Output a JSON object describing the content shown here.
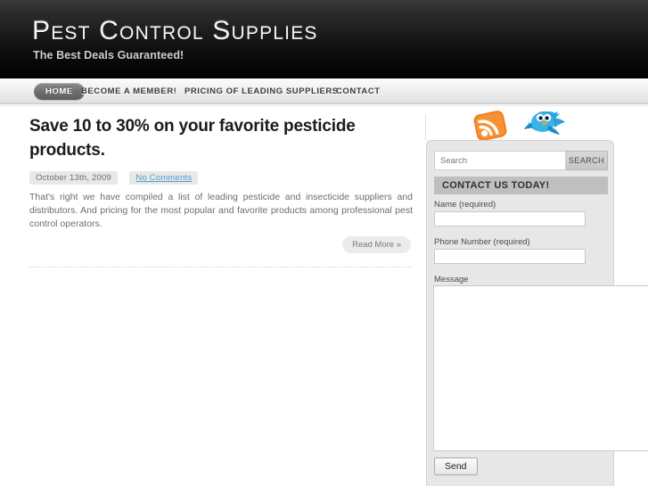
{
  "header": {
    "title": "Pest Control Supplies",
    "tagline": "The Best Deals Guaranteed!"
  },
  "nav": {
    "items": [
      {
        "label": "HOME",
        "active": true
      },
      {
        "label": "BECOME A MEMBER!",
        "active": false
      },
      {
        "label": "PRICING OF LEADING SUPPLIERS",
        "active": false
      },
      {
        "label": "CONTACT",
        "active": false
      }
    ]
  },
  "post": {
    "title": "Save 10 to 30% on your favorite pesticide products.",
    "date": "October 13th, 2009",
    "comments_link": "No Comments",
    "body": "That's right we have compiled a list of leading pesticide and insecticide suppliers and distributors. And pricing for the most popular and favorite products among professional pest control operators.",
    "read_more": "Read More »"
  },
  "sidebar": {
    "social": [
      {
        "name": "rss-icon",
        "color": "#f08022"
      },
      {
        "name": "twitter-icon",
        "color": "#2ca3dc"
      }
    ],
    "search": {
      "placeholder": "Search",
      "value": "",
      "button_label": "SEARCH"
    },
    "contact_form": {
      "heading": "CONTACT US TODAY!",
      "fields": [
        {
          "label": "Name (required)",
          "value": ""
        },
        {
          "label": "Phone Number (required)",
          "value": ""
        },
        {
          "label": "Message",
          "value": ""
        }
      ],
      "submit_label": "Send"
    }
  },
  "colors": {
    "header_bg": "#101010",
    "nav_bg": "#f0f0f0",
    "accent_link": "#4d9fd0",
    "sidebar_bg": "#e7e7e7",
    "heading_bar": "#bfbfbf"
  }
}
